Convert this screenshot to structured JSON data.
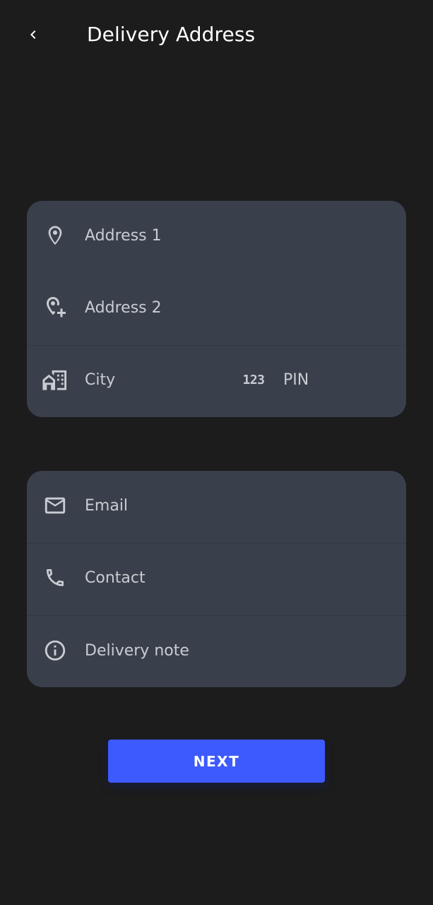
{
  "app_bar": {
    "title": "Delivery Address",
    "back_icon": "chevron-left-icon"
  },
  "address_card": {
    "address1": {
      "placeholder": "Address 1",
      "value": "",
      "icon": "location-pin-icon"
    },
    "address2": {
      "placeholder": "Address 2",
      "value": "",
      "icon": "add-location-icon"
    },
    "city": {
      "placeholder": "City",
      "value": "",
      "icon": "city-icon"
    },
    "pin": {
      "placeholder": "PIN",
      "value": "",
      "icon": "numbers-icon",
      "icon_text": "123"
    }
  },
  "contact_card": {
    "email": {
      "placeholder": "Email",
      "value": "",
      "icon": "mail-icon"
    },
    "contact": {
      "placeholder": "Contact",
      "value": "",
      "icon": "phone-icon"
    },
    "note": {
      "placeholder": "Delivery note",
      "value": "",
      "icon": "info-icon"
    }
  },
  "next_button": {
    "label": "NEXT"
  },
  "colors": {
    "background": "#1c1c1d",
    "card": "#39404b",
    "accent": "#3d5afe",
    "text": "#ffffff",
    "placeholder": "#c9ccd2"
  }
}
